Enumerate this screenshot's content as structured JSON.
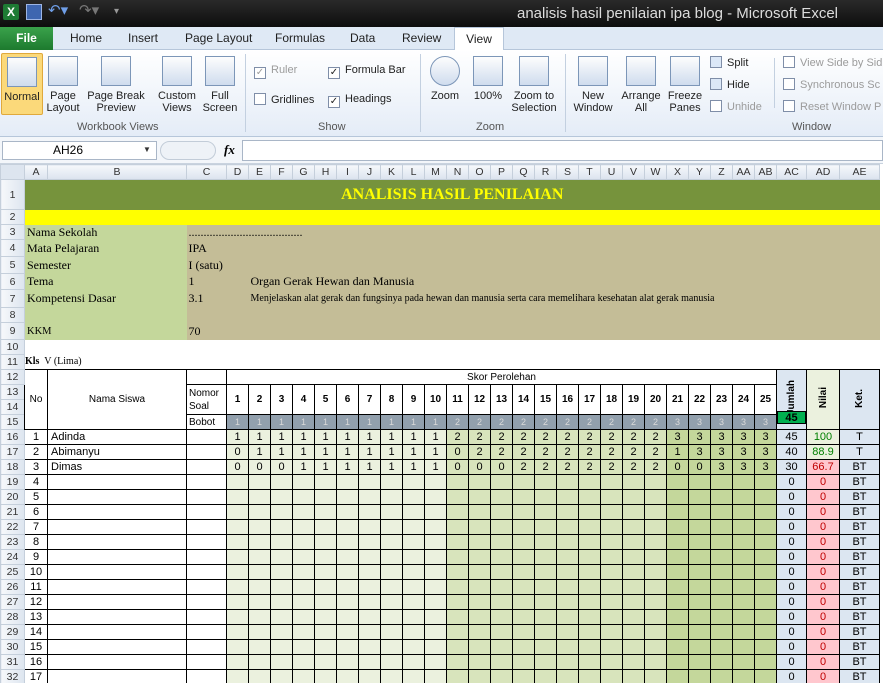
{
  "window": {
    "title": "analisis hasil penilaian ipa blog - Microsoft Excel",
    "app_icon": "excel-icon"
  },
  "tabs": [
    "File",
    "Home",
    "Insert",
    "Page Layout",
    "Formulas",
    "Data",
    "Review",
    "View"
  ],
  "ribbon": {
    "workbook_views": {
      "label": "Workbook Views",
      "normal": "Normal",
      "page_layout": "Page Layout",
      "page_break_preview": "Page Break Preview",
      "custom_views": "Custom Views",
      "full_screen": "Full Screen"
    },
    "show": {
      "label": "Show",
      "ruler": "Ruler",
      "gridlines": "Gridlines",
      "formula_bar": "Formula Bar",
      "headings": "Headings"
    },
    "zoom": {
      "label": "Zoom",
      "zoom": "Zoom",
      "zoom_100": "100%",
      "zoom_to_selection": "Zoom to Selection"
    },
    "window": {
      "label": "Window",
      "new_window": "New Window",
      "arrange_all": "Arrange All",
      "freeze_panes": "Freeze Panes",
      "split": "Split",
      "hide": "Hide",
      "unhide": "Unhide",
      "side_by_side": "View Side by Sid",
      "sync_scroll": "Synchronous Sc",
      "reset_pos": "Reset Window P"
    }
  },
  "formula_bar": {
    "name_box": "AH26",
    "fx": "fx",
    "formula": ""
  },
  "columns": [
    "A",
    "B",
    "C",
    "D",
    "E",
    "F",
    "G",
    "H",
    "I",
    "J",
    "K",
    "L",
    "M",
    "N",
    "O",
    "P",
    "Q",
    "R",
    "S",
    "T",
    "U",
    "V",
    "W",
    "X",
    "Y",
    "Z",
    "AA",
    "AB",
    "AC",
    "AD",
    "AE"
  ],
  "sheet": {
    "title": "ANALISIS HASIL PENILAIAN",
    "info": [
      {
        "label": "Nama Sekolah",
        "value": "......................................"
      },
      {
        "label": "Mata Pelajaran",
        "value": "IPA"
      },
      {
        "label": "Semester",
        "value": " I (satu)"
      },
      {
        "label": "Tema",
        "num": "1",
        "value": "Organ Gerak Hewan dan Manusia"
      },
      {
        "label": "Kompetensi Dasar",
        "num": "3.1",
        "value": "Menjelaskan alat gerak dan fungsinya pada hewan dan manusia serta cara memelihara kesehatan alat gerak manusia"
      },
      {
        "label": "KKM",
        "value": "70"
      }
    ],
    "kls_label": "Kls",
    "kls_value": "V (Lima)",
    "headers": {
      "no": "No",
      "nama": "Nama Siswa",
      "nomor_soal": "Nomor Soal",
      "bobot": "Bobot",
      "skor": "Skor Perolehan",
      "jumlah": "Jumlah",
      "nilai": "Nilai",
      "ket": "Ket."
    },
    "questions": [
      "1",
      "2",
      "3",
      "4",
      "5",
      "6",
      "7",
      "8",
      "9",
      "10",
      "11",
      "12",
      "13",
      "14",
      "15",
      "16",
      "17",
      "18",
      "19",
      "20",
      "21",
      "22",
      "23",
      "24",
      "25"
    ],
    "bobot": [
      "1",
      "1",
      "1",
      "1",
      "1",
      "1",
      "1",
      "1",
      "1",
      "1",
      "2",
      "2",
      "2",
      "2",
      "2",
      "2",
      "2",
      "2",
      "2",
      "2",
      "3",
      "3",
      "3",
      "3",
      "3"
    ],
    "total_bobot": "45",
    "students": [
      {
        "no": "1",
        "name": "Adinda",
        "scores": [
          "1",
          "1",
          "1",
          "1",
          "1",
          "1",
          "1",
          "1",
          "1",
          "1",
          "2",
          "2",
          "2",
          "2",
          "2",
          "2",
          "2",
          "2",
          "2",
          "2",
          "3",
          "3",
          "3",
          "3",
          "3"
        ],
        "jumlah": "45",
        "nilai": "100",
        "ket": "T"
      },
      {
        "no": "2",
        "name": "Abimanyu",
        "scores": [
          "0",
          "1",
          "1",
          "1",
          "1",
          "1",
          "1",
          "1",
          "1",
          "1",
          "0",
          "2",
          "2",
          "2",
          "2",
          "2",
          "2",
          "2",
          "2",
          "2",
          "1",
          "3",
          "3",
          "3",
          "3"
        ],
        "jumlah": "40",
        "nilai": "88.9",
        "ket": "T"
      },
      {
        "no": "3",
        "name": "Dimas",
        "scores": [
          "0",
          "0",
          "0",
          "1",
          "1",
          "1",
          "1",
          "1",
          "1",
          "1",
          "0",
          "0",
          "0",
          "2",
          "2",
          "2",
          "2",
          "2",
          "2",
          "2",
          "0",
          "0",
          "3",
          "3",
          "3"
        ],
        "jumlah": "30",
        "nilai": "66.7",
        "ket": "BT"
      },
      {
        "no": "4",
        "name": "",
        "scores": [],
        "jumlah": "0",
        "nilai": "0",
        "ket": "BT"
      },
      {
        "no": "5",
        "name": "",
        "scores": [],
        "jumlah": "0",
        "nilai": "0",
        "ket": "BT"
      },
      {
        "no": "6",
        "name": "",
        "scores": [],
        "jumlah": "0",
        "nilai": "0",
        "ket": "BT"
      },
      {
        "no": "7",
        "name": "",
        "scores": [],
        "jumlah": "0",
        "nilai": "0",
        "ket": "BT"
      },
      {
        "no": "8",
        "name": "",
        "scores": [],
        "jumlah": "0",
        "nilai": "0",
        "ket": "BT"
      },
      {
        "no": "9",
        "name": "",
        "scores": [],
        "jumlah": "0",
        "nilai": "0",
        "ket": "BT"
      },
      {
        "no": "10",
        "name": "",
        "scores": [],
        "jumlah": "0",
        "nilai": "0",
        "ket": "BT"
      },
      {
        "no": "11",
        "name": "",
        "scores": [],
        "jumlah": "0",
        "nilai": "0",
        "ket": "BT"
      },
      {
        "no": "12",
        "name": "",
        "scores": [],
        "jumlah": "0",
        "nilai": "0",
        "ket": "BT"
      },
      {
        "no": "13",
        "name": "",
        "scores": [],
        "jumlah": "0",
        "nilai": "0",
        "ket": "BT"
      },
      {
        "no": "14",
        "name": "",
        "scores": [],
        "jumlah": "0",
        "nilai": "0",
        "ket": "BT"
      },
      {
        "no": "15",
        "name": "",
        "scores": [],
        "jumlah": "0",
        "nilai": "0",
        "ket": "BT"
      },
      {
        "no": "16",
        "name": "",
        "scores": [],
        "jumlah": "0",
        "nilai": "0",
        "ket": "BT"
      },
      {
        "no": "17",
        "name": "",
        "scores": [],
        "jumlah": "0",
        "nilai": "0",
        "ket": "BT"
      }
    ]
  },
  "colors": {
    "title_bg": "#76933c",
    "title_text": "#ffff00",
    "label_bg": "#c4d79b",
    "value_bg": "#c4bd97",
    "fail_bg": "#ffc7ce",
    "fail_text": "#c00000"
  }
}
